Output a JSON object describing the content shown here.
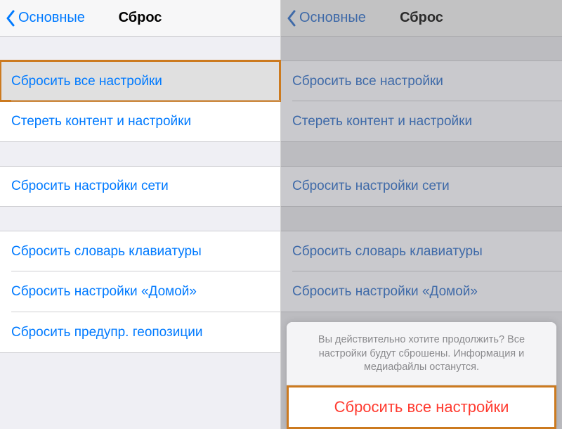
{
  "left": {
    "nav": {
      "back": "Основные",
      "title": "Сброс"
    },
    "groups": [
      {
        "items": [
          {
            "label": "Сбросить все настройки",
            "highlighted": true
          },
          {
            "label": "Стереть контент и настройки"
          }
        ]
      },
      {
        "items": [
          {
            "label": "Сбросить настройки сети"
          }
        ]
      },
      {
        "items": [
          {
            "label": "Сбросить словарь клавиатуры"
          },
          {
            "label": "Сбросить настройки «Домой»"
          },
          {
            "label": "Сбросить предупр. геопозиции"
          }
        ]
      }
    ]
  },
  "right": {
    "nav": {
      "back": "Основные",
      "title": "Сброс"
    },
    "groups": [
      {
        "items": [
          {
            "label": "Сбросить все настройки"
          },
          {
            "label": "Стереть контент и настройки"
          }
        ]
      },
      {
        "items": [
          {
            "label": "Сбросить настройки сети"
          }
        ]
      },
      {
        "items": [
          {
            "label": "Сбросить словарь клавиатуры"
          },
          {
            "label": "Сбросить настройки «Домой»"
          }
        ]
      }
    ],
    "sheet": {
      "message": "Вы действительно хотите продолжить? Все настройки будут сброшены. Информация и медиафайлы останутся.",
      "confirm": "Сбросить все настройки"
    }
  },
  "colors": {
    "ios_blue": "#007aff",
    "ios_red": "#ff3b30",
    "highlight_border": "#cc7a1f"
  }
}
